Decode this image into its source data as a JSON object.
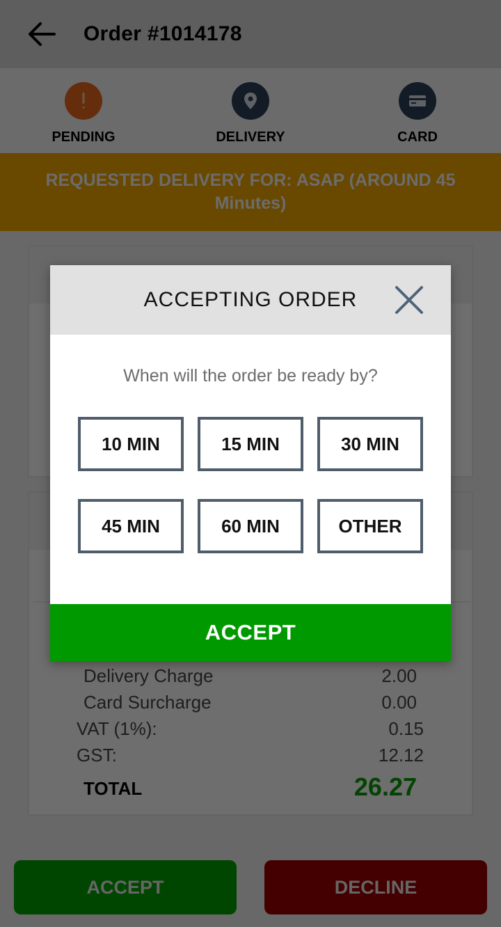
{
  "header": {
    "title": "Order #1014178",
    "back_icon": "arrow-left-icon"
  },
  "status": [
    {
      "label": "PENDING",
      "icon": "exclamation-icon",
      "color": "#e8661c"
    },
    {
      "label": "DELIVERY",
      "icon": "location-pin-icon",
      "color": "#2b3f58"
    },
    {
      "label": "CARD",
      "icon": "credit-card-icon",
      "color": "#2b3f58"
    }
  ],
  "banner": {
    "text": "REQUESTED DELIVERY FOR: ASAP (AROUND 45 Minutes)",
    "color": "#f0a500"
  },
  "summary": {
    "rows": [
      {
        "label": "Delivery Charge",
        "value": "2.00"
      },
      {
        "label": "Card Surcharge",
        "value": "0.00"
      },
      {
        "label": "VAT (1%):",
        "value": "0.15"
      },
      {
        "label": "GST:",
        "value": "12.12"
      }
    ],
    "total_label": "TOTAL",
    "total_value": "26.27"
  },
  "actions": {
    "accept": "ACCEPT",
    "decline": "DECLINE"
  },
  "modal": {
    "title": "ACCEPTING ORDER",
    "close_icon": "close-icon",
    "prompt": "When will the order be ready by?",
    "options": [
      "10 MIN",
      "15 MIN",
      "30 MIN",
      "45 MIN",
      "60 MIN",
      "OTHER"
    ],
    "accept_label": "ACCEPT",
    "accept_color": "#009a00"
  }
}
